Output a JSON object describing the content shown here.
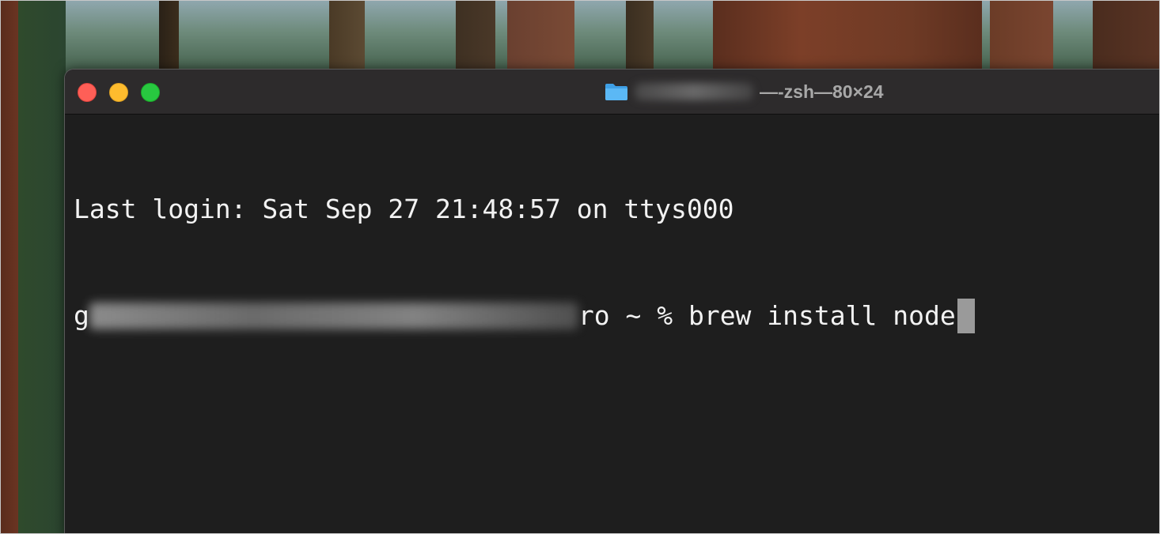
{
  "window": {
    "title_separator_1": " — ",
    "title_shell": "-zsh",
    "title_separator_2": " — ",
    "title_size": "80×24",
    "colors": {
      "close": "#fe5f57",
      "minimize": "#febc2e",
      "zoom": "#28c840",
      "background": "#1e1e1e",
      "text": "#f2f2f2"
    }
  },
  "terminal": {
    "last_login": "Last login: Sat Sep 27 21:48:57 on ttys000",
    "prompt_suffix": "ro ~ % ",
    "prompt_prefix": "g",
    "command": "brew install node"
  }
}
